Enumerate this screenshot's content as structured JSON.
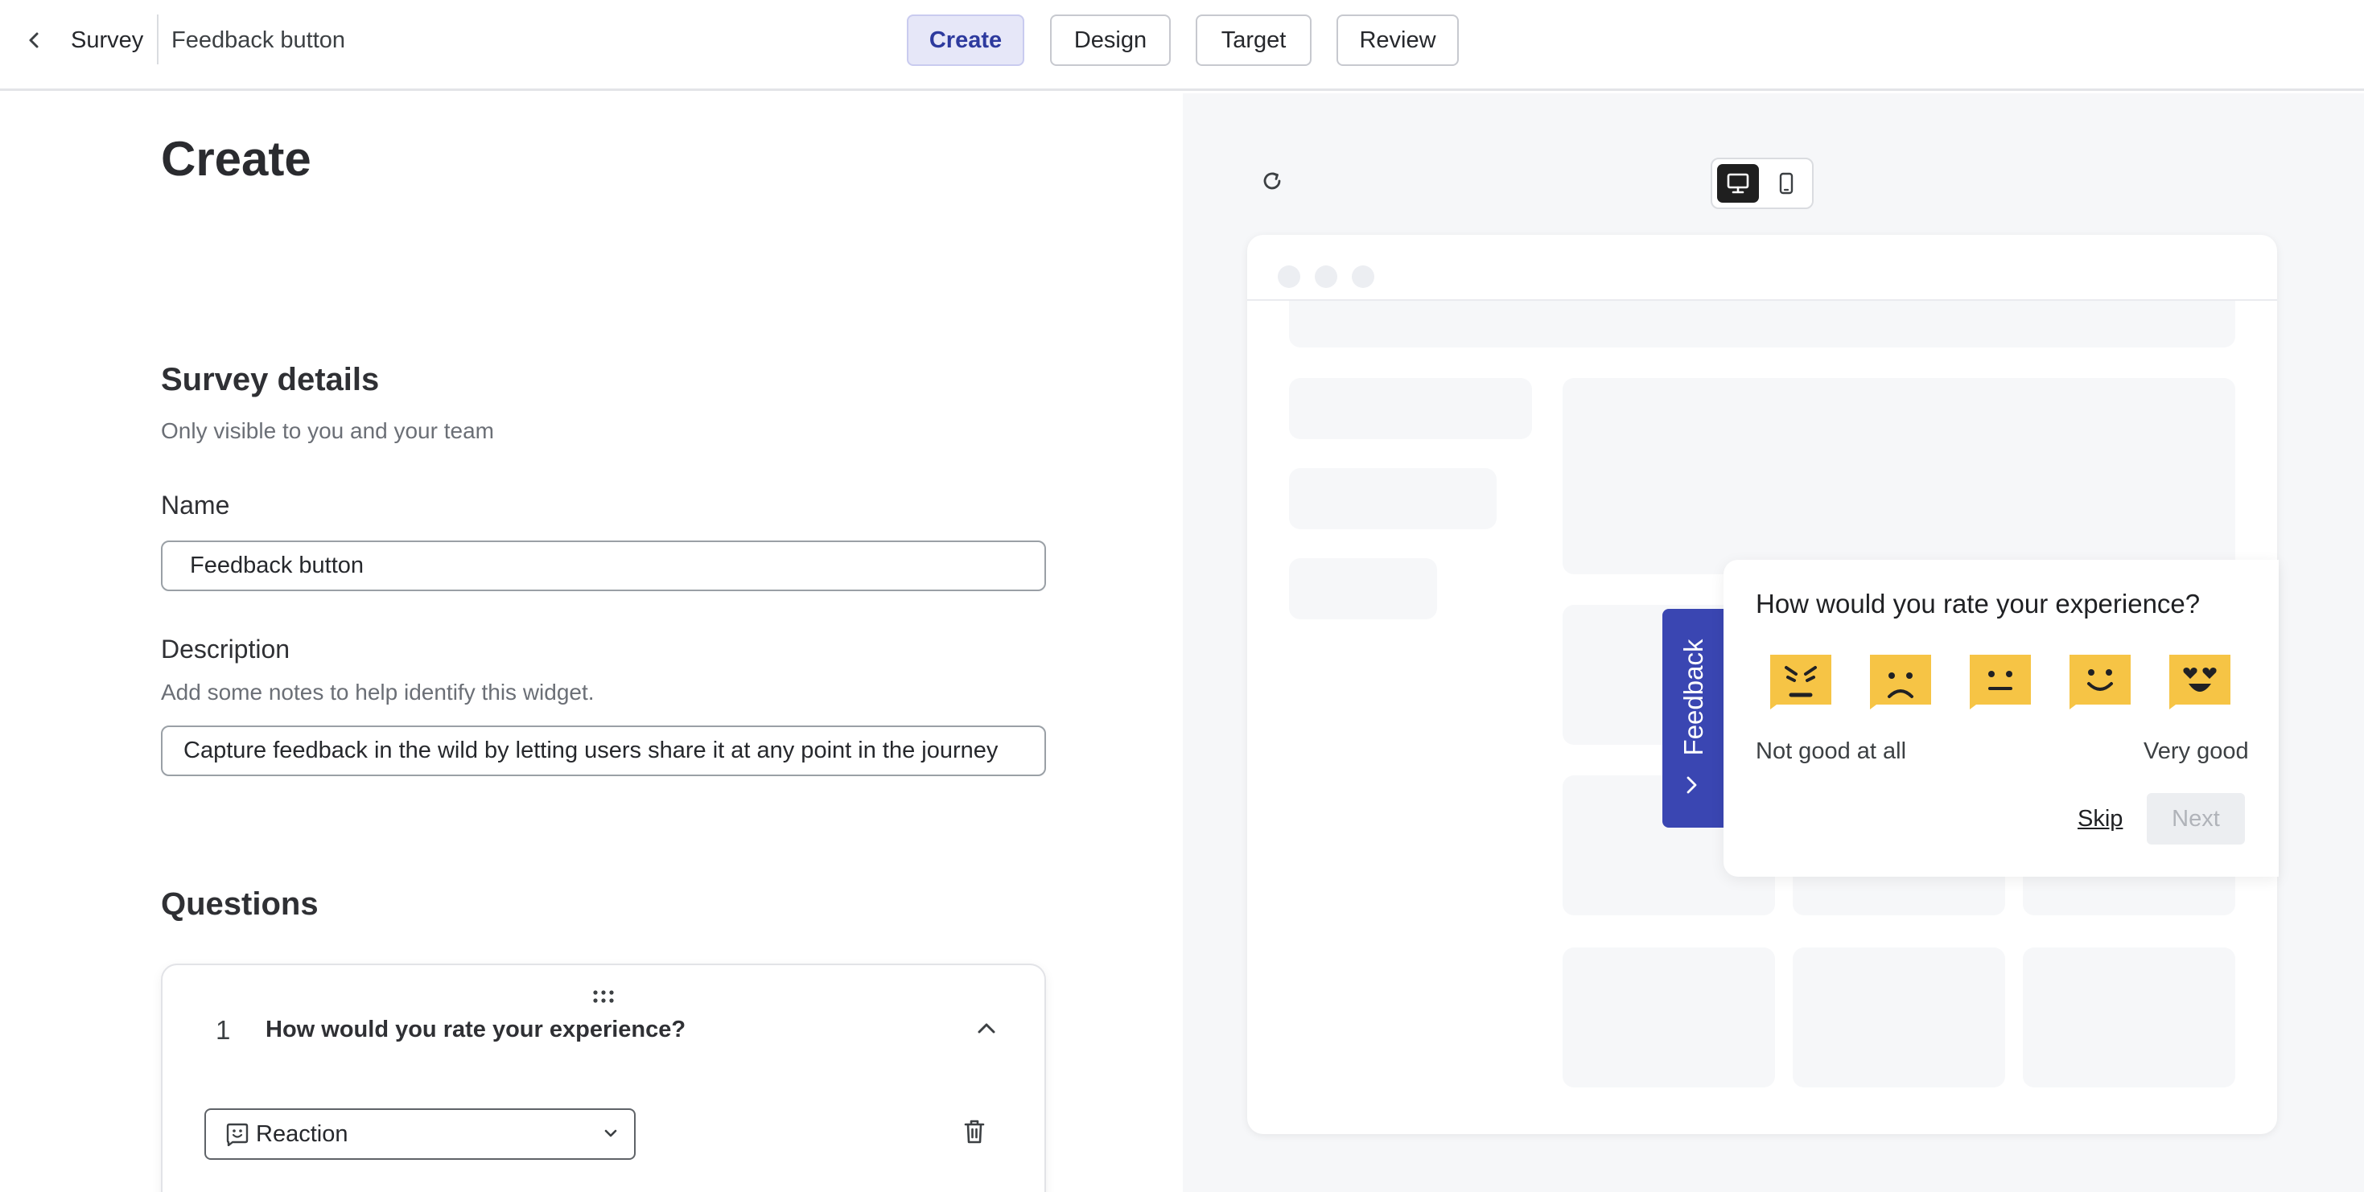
{
  "header": {
    "back_label": "Survey",
    "survey_name": "Feedback button",
    "tabs": [
      {
        "label": "Create",
        "active": true
      },
      {
        "label": "Design",
        "active": false
      },
      {
        "label": "Target",
        "active": false
      },
      {
        "label": "Review",
        "active": false
      }
    ]
  },
  "main": {
    "title": "Create",
    "details": {
      "title": "Survey details",
      "subtitle": "Only visible to you and your team",
      "name_label": "Name",
      "name_value": "Feedback button",
      "description_label": "Description",
      "description_hint": "Add some notes to help identify this widget.",
      "description_value": "Capture feedback in the wild by letting users share it at any point in the journey"
    },
    "questions": {
      "title": "Questions",
      "items": [
        {
          "number": "1",
          "text": "How would you rate your experience?",
          "type": "Reaction"
        }
      ]
    }
  },
  "preview": {
    "feedback_tab_label": "Feedback",
    "popup": {
      "question": "How would you rate your experience?",
      "low_label": "Not good at all",
      "high_label": "Very good",
      "skip_label": "Skip",
      "next_label": "Next"
    },
    "emoji_icons": [
      "angry-face-icon",
      "sad-face-icon",
      "neutral-face-icon",
      "smile-face-icon",
      "heart-eyes-face-icon"
    ]
  },
  "colors": {
    "accent": "#3a46b2",
    "active_tab_bg": "#e6e7f8",
    "emoji_yellow": "#f6c445",
    "preview_bg": "#f6f7f9"
  }
}
